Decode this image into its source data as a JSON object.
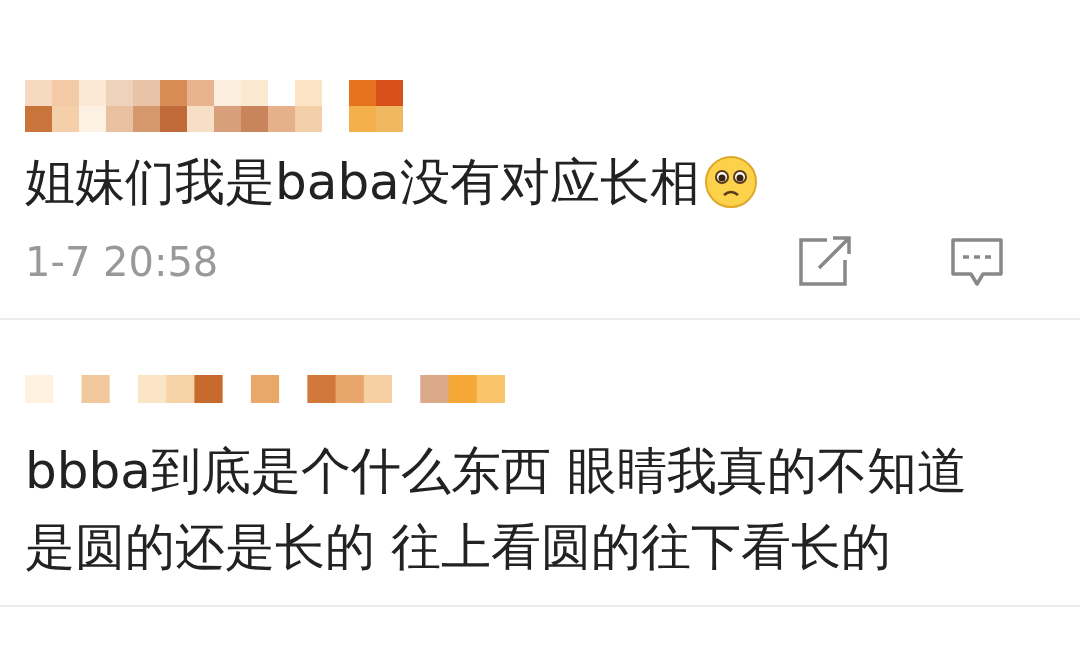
{
  "comments": [
    {
      "text": "姐妹们我是baba没有对应长相",
      "time": "1-7 20:58"
    },
    {
      "lines": [
        "bbba到底是个什么东西 眼睛我真的不知道",
        "是圆的还是长的 往上看圆的往下看长的"
      ]
    }
  ]
}
